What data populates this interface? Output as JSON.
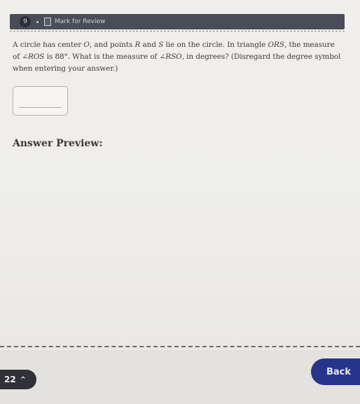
{
  "header": {
    "question_number": "9",
    "mark_for_review_label": "Mark for Review"
  },
  "question": {
    "text_parts": {
      "p1": "A circle has center ",
      "center": "O",
      "p2": ", and points ",
      "r": "R",
      "p3": " and ",
      "s": "S",
      "p4": " lie on the circle. In triangle ",
      "tri": "ORS",
      "p5": ", the measure of ∠",
      "angle1": "ROS",
      "p6": " is 88°. What is the measure of ∠",
      "angle2": "RSO",
      "p7": ", in degrees? (Disregard the degree symbol when entering your answer.)"
    }
  },
  "answer": {
    "value": "",
    "preview_label": "Answer Preview:"
  },
  "footer": {
    "question_nav_label": "22",
    "chevron_icon": "chevron-up-icon",
    "back_label": "Back"
  }
}
